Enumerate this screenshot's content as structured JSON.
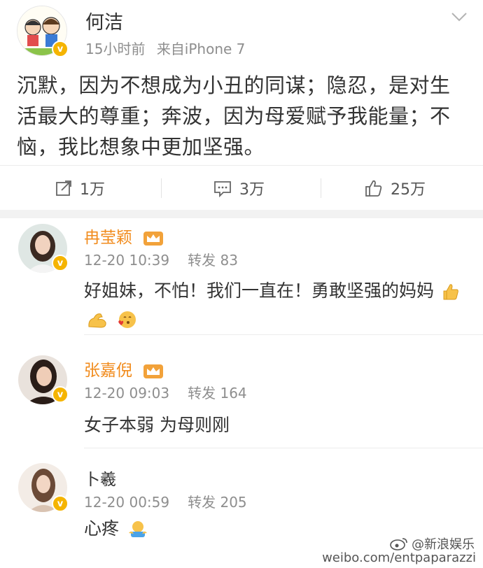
{
  "post": {
    "author": "何洁",
    "time": "15小时前",
    "source": "来自iPhone 7",
    "text": "沉默，因为不想成为小丑的同谋；隐忍，是对生活最大的尊重；奔波，因为母爱赋予我能量；不恼，我比想象中更加坚强。",
    "verified_mark": "v"
  },
  "actions": {
    "repost_count": "1万",
    "comment_count": "3万",
    "like_count": "25万"
  },
  "comments": [
    {
      "name": "冉莹颖",
      "time": "12-20 10:39",
      "repost": "转发 83",
      "text": "好姐妹，不怕！我们一直在！勇敢坚强的妈妈",
      "emojis": [
        "thumbs-up-icon",
        "flexed-biceps-icon",
        "kissing-heart-icon"
      ]
    },
    {
      "name": "张嘉倪",
      "time": "12-20 09:03",
      "repost": "转发 164",
      "text": "女子本弱 为母则刚"
    },
    {
      "name": "卜羲",
      "time": "12-20 00:59",
      "repost": "转发 205",
      "text": "心疼",
      "emojis": [
        "hug-icon"
      ]
    }
  ],
  "watermark": {
    "brand": "@新浪娱乐",
    "url": "weibo.com/entpaparazzi"
  },
  "colors": {
    "vip_name": "#f18b1c",
    "badge": "#f5b400",
    "meta": "#8e8e8e"
  }
}
